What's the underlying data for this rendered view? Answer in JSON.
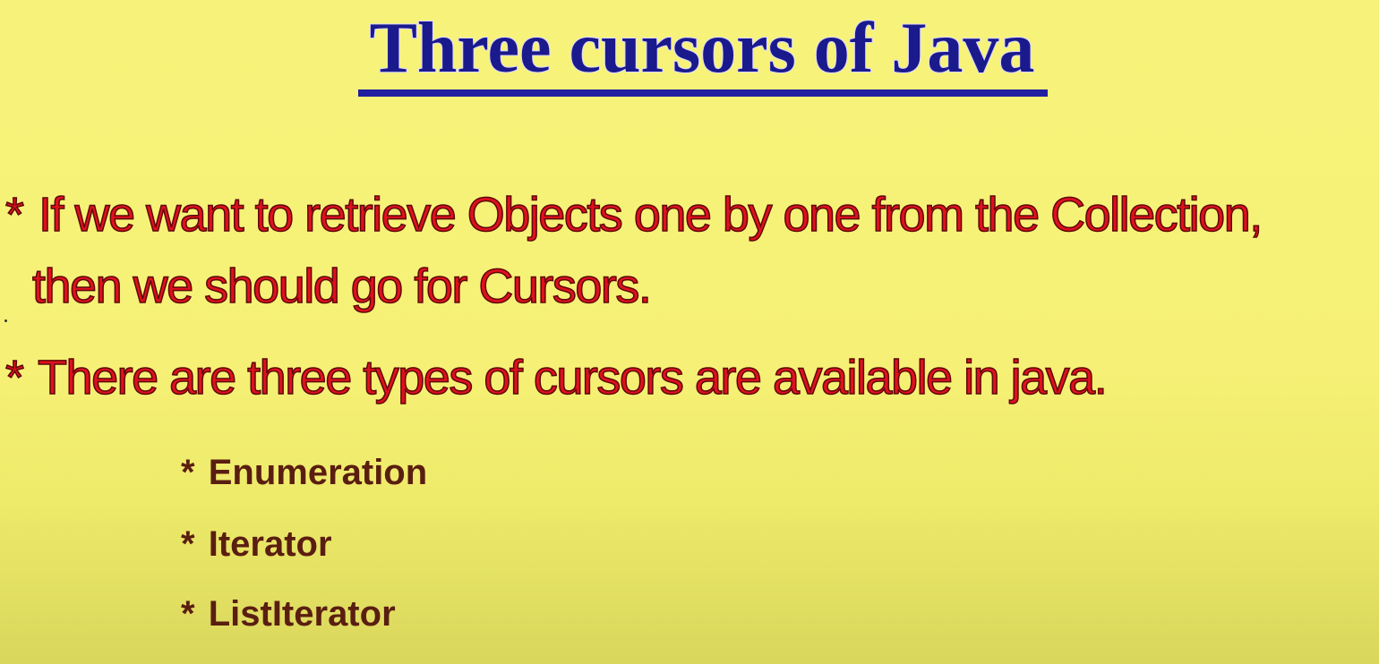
{
  "slide": {
    "title": "Three cursors of Java",
    "bullets": [
      {
        "star": "*",
        "line1": "If we want to retrieve Objects one by one from the Collection,",
        "line2": "then we should go for Cursors."
      },
      {
        "star": "*",
        "line1": "There are three types of cursors are available in java."
      }
    ],
    "sub_items": [
      {
        "star": "*",
        "label": "Enumeration"
      },
      {
        "star": "*",
        "label": "Iterator"
      },
      {
        "star": "*",
        "label": "ListIterator"
      }
    ],
    "colors": {
      "background": "#f7f37a",
      "title": "#1a1a8c",
      "underline": "#1f1fa0",
      "bullet_text": "#e0101e",
      "sub_text": "#5a1e10"
    }
  }
}
